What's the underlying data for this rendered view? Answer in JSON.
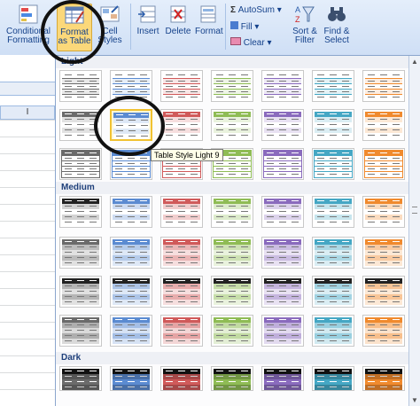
{
  "ribbon": {
    "conditional_formatting": "Conditional Formatting",
    "format_as_table": "Format as Table",
    "cell_styles": "Cell Styles",
    "insert": "Insert",
    "delete": "Delete",
    "format": "Format",
    "autosum": "AutoSum",
    "fill": "Fill",
    "clear": "Clear",
    "sort_filter": "Sort & Filter",
    "find_select": "Find & Select"
  },
  "sheet": {
    "column_letter": "I"
  },
  "gallery": {
    "section_light": "Light",
    "section_medium": "Medium",
    "section_dark": "Dark",
    "tooltip": "Table Style Light 9",
    "colors": [
      "#6b6b6b",
      "#5b8bd1",
      "#d05a5a",
      "#8fbc55",
      "#8a6bbd",
      "#45a7c4",
      "#f08a2e"
    ]
  }
}
